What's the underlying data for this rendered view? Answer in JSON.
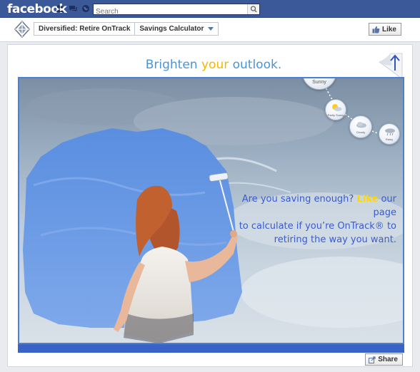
{
  "topbar": {
    "logo": "facebook",
    "search_placeholder": "Search"
  },
  "app_header": {
    "page_name": "Diversified: Retire OnTrack",
    "app_name": "Savings Calculator",
    "like_label": "Like"
  },
  "content": {
    "headline_part1": "Brighten ",
    "headline_highlight": "your",
    "headline_part2": " outlook.",
    "cta_line1_a": "Are you saving enough? ",
    "cta_like": "Like",
    "cta_line1_b": " our page",
    "cta_line2": "to calculate if you’re OnTrack® to",
    "cta_line3": "retiring the way you want.",
    "weather": {
      "sunny": "Sunny",
      "partly_sunny": "Partly Sunny",
      "cloudy": "Cloudy",
      "rainy": "Rainy"
    },
    "share_label": "Share"
  },
  "colors": {
    "facebook_blue": "#3b5998",
    "headline_blue": "#4a95d6",
    "highlight_yellow": "#f0b800",
    "cta_blue": "#3a5bd0",
    "frame_blue": "#4d7fd6"
  }
}
